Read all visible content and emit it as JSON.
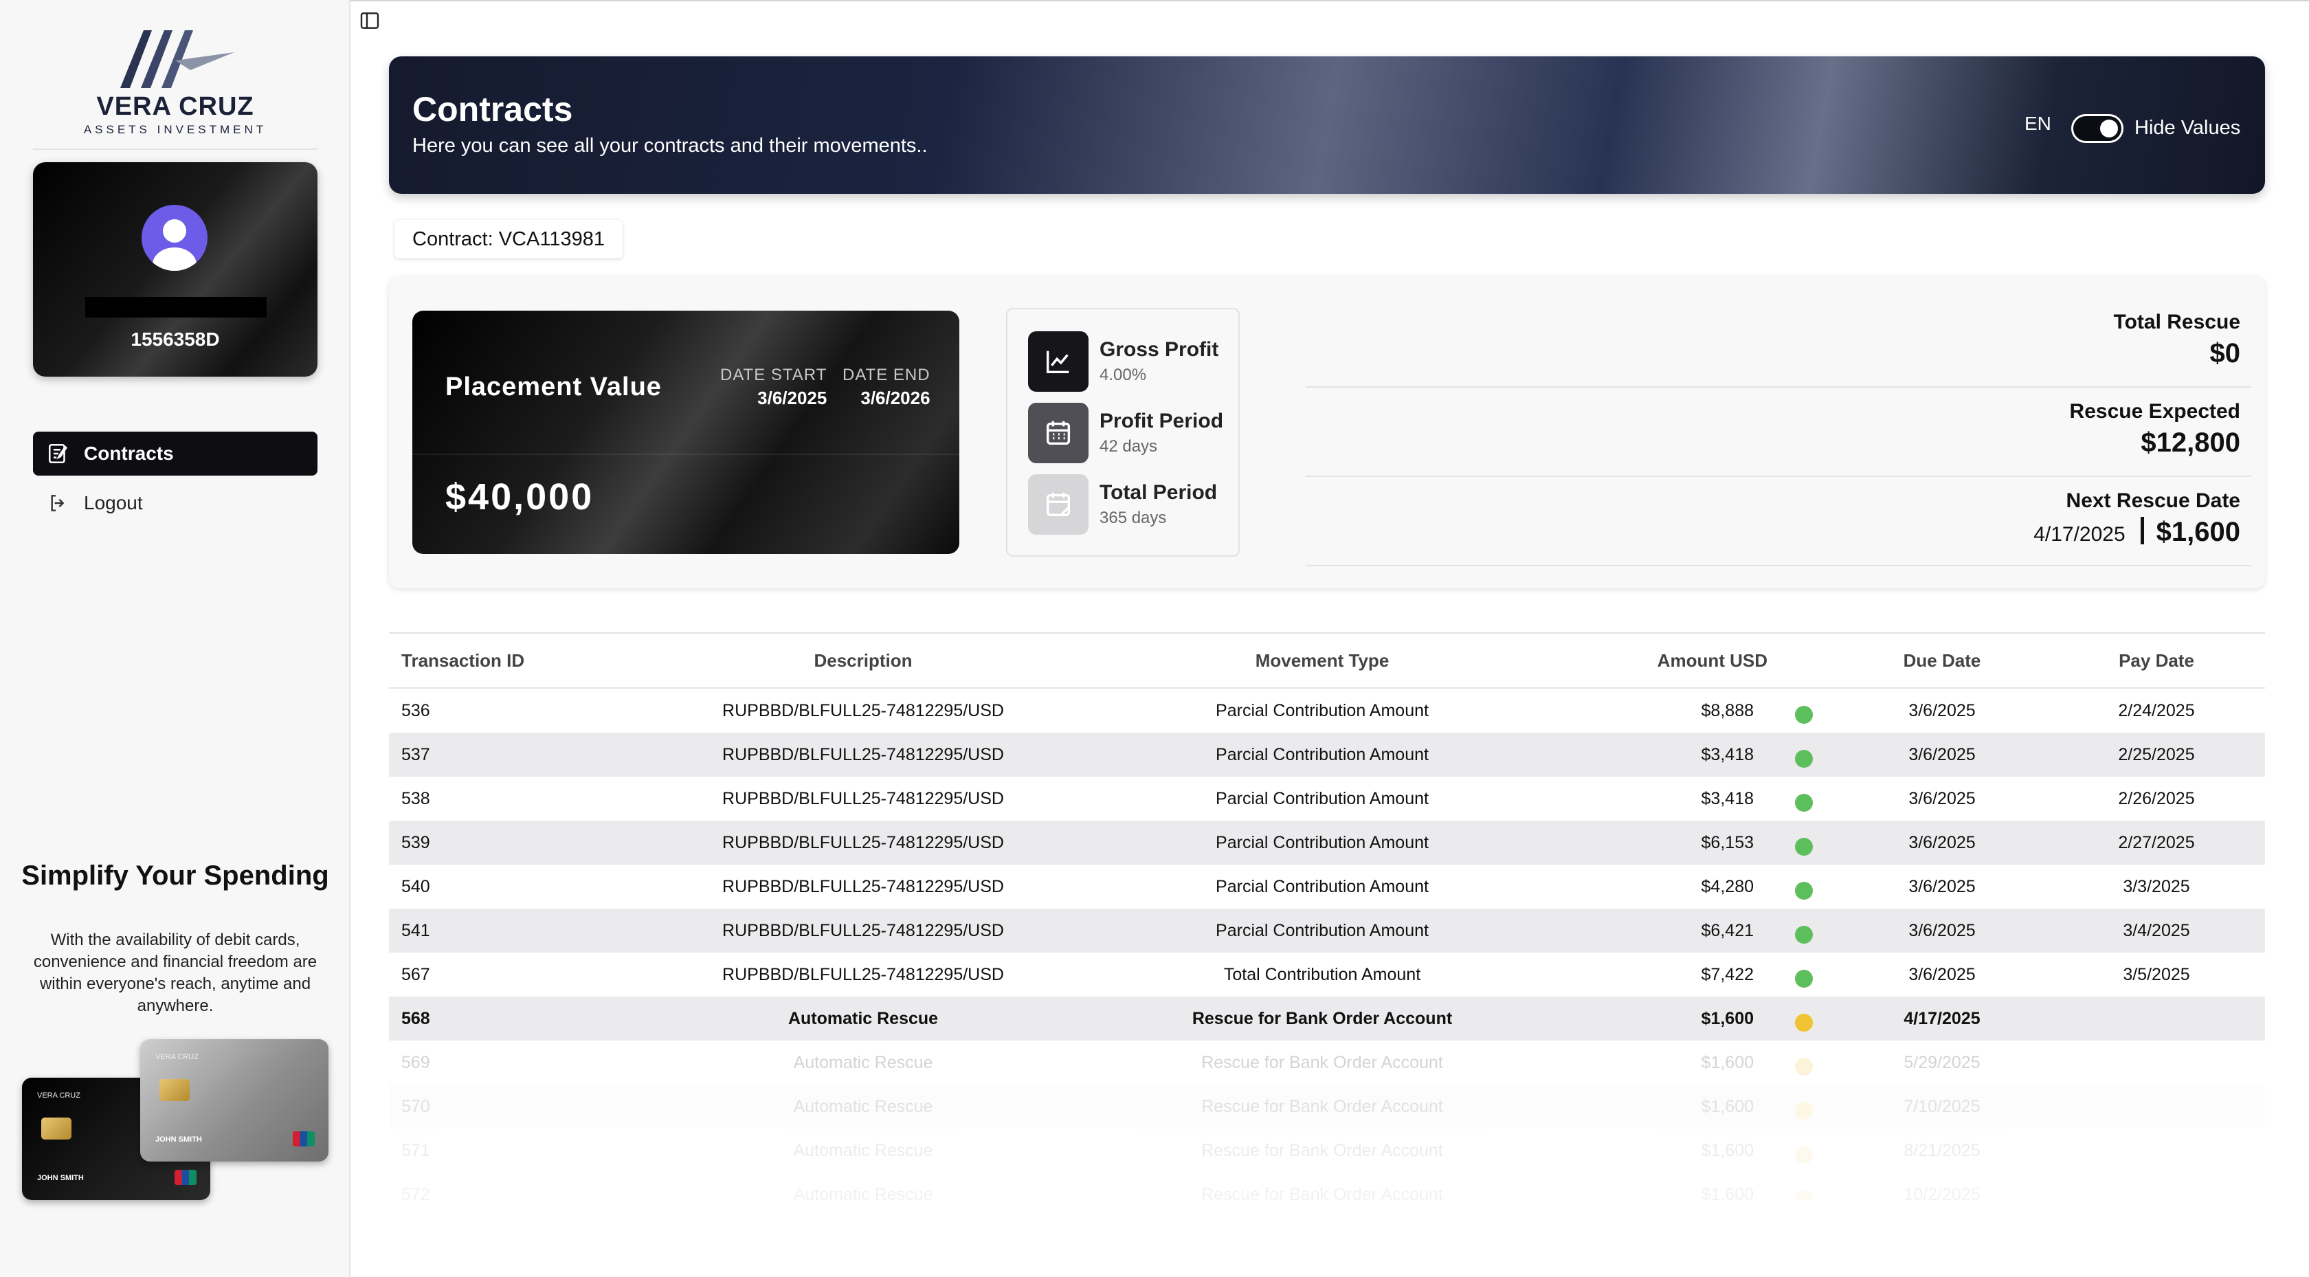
{
  "brand": {
    "name": "VERA CRUZ",
    "subtitle": "ASSETS INVESTMENT"
  },
  "profile": {
    "id": "1556358D"
  },
  "nav": [
    {
      "label": "Contracts",
      "icon": "contract-icon",
      "active": true
    },
    {
      "label": "Logout",
      "icon": "logout-icon",
      "active": false
    }
  ],
  "promo": {
    "title": "Simplify Your Spending",
    "text": "With the availability of debit cards, convenience and financial freedom are within everyone's reach, anytime and anywhere.",
    "card_brand": "VERA CRUZ",
    "card_holder": "JOHN SMITH"
  },
  "header": {
    "title": "Contracts",
    "subtitle": "Here you can see all your contracts and their movements..",
    "language": "EN",
    "hide_values_label": "Hide Values",
    "hide_values_on": true
  },
  "contract": {
    "label": "Contract: VCA113981"
  },
  "placement": {
    "label": "Placement Value",
    "value": "$40,000",
    "date_start_label": "DATE START",
    "date_start": "3/6/2025",
    "date_end_label": "DATE END",
    "date_end": "3/6/2026"
  },
  "stats": [
    {
      "title": "Gross Profit",
      "value": "4.00%",
      "icon": "chart-line-icon"
    },
    {
      "title": "Profit Period",
      "value": "42 days",
      "icon": "calendar-icon"
    },
    {
      "title": "Total Period",
      "value": "365 days",
      "icon": "calendar-note-icon"
    }
  ],
  "rescue": {
    "total_label": "Total Rescue",
    "total_value": "$0",
    "expected_label": "Rescue Expected",
    "expected_value": "$12,800",
    "next_label": "Next Rescue Date",
    "next_date": "4/17/2025",
    "next_value": "$1,600"
  },
  "table": {
    "columns": [
      "Transaction ID",
      "Description",
      "Movement Type",
      "Amount USD",
      "Due Date",
      "Pay Date"
    ],
    "status_colors": {
      "paid": "#5cbf5c",
      "pending": "#f1c232"
    },
    "rows": [
      {
        "id": "536",
        "desc": "RUPBBD/BLFULL25-74812295/USD",
        "type": "Parcial Contribution Amount",
        "amount": "$8,888",
        "status": "paid",
        "due": "3/6/2025",
        "pay": "2/24/2025"
      },
      {
        "id": "537",
        "desc": "RUPBBD/BLFULL25-74812295/USD",
        "type": "Parcial Contribution Amount",
        "amount": "$3,418",
        "status": "paid",
        "due": "3/6/2025",
        "pay": "2/25/2025"
      },
      {
        "id": "538",
        "desc": "RUPBBD/BLFULL25-74812295/USD",
        "type": "Parcial Contribution Amount",
        "amount": "$3,418",
        "status": "paid",
        "due": "3/6/2025",
        "pay": "2/26/2025"
      },
      {
        "id": "539",
        "desc": "RUPBBD/BLFULL25-74812295/USD",
        "type": "Parcial Contribution Amount",
        "amount": "$6,153",
        "status": "paid",
        "due": "3/6/2025",
        "pay": "2/27/2025"
      },
      {
        "id": "540",
        "desc": "RUPBBD/BLFULL25-74812295/USD",
        "type": "Parcial Contribution Amount",
        "amount": "$4,280",
        "status": "paid",
        "due": "3/6/2025",
        "pay": "3/3/2025"
      },
      {
        "id": "541",
        "desc": "RUPBBD/BLFULL25-74812295/USD",
        "type": "Parcial Contribution Amount",
        "amount": "$6,421",
        "status": "paid",
        "due": "3/6/2025",
        "pay": "3/4/2025"
      },
      {
        "id": "567",
        "desc": "RUPBBD/BLFULL25-74812295/USD",
        "type": "Total Contribution Amount",
        "amount": "$7,422",
        "status": "paid",
        "due": "3/6/2025",
        "pay": "3/5/2025"
      },
      {
        "id": "568",
        "desc": "Automatic Rescue",
        "type": "Rescue for Bank Order Account",
        "amount": "$1,600",
        "status": "pending",
        "due": "4/17/2025",
        "pay": ""
      },
      {
        "id": "569",
        "desc": "Automatic Rescue",
        "type": "Rescue for Bank Order Account",
        "amount": "$1,600",
        "status": "pending",
        "due": "5/29/2025",
        "pay": ""
      },
      {
        "id": "570",
        "desc": "Automatic Rescue",
        "type": "Rescue for Bank Order Account",
        "amount": "$1,600",
        "status": "pending",
        "due": "7/10/2025",
        "pay": ""
      },
      {
        "id": "571",
        "desc": "Automatic Rescue",
        "type": "Rescue for Bank Order Account",
        "amount": "$1,600",
        "status": "pending",
        "due": "8/21/2025",
        "pay": ""
      },
      {
        "id": "572",
        "desc": "Automatic Rescue",
        "type": "Rescue for Bank Order Account",
        "amount": "$1,600",
        "status": "pending",
        "due": "10/2/2025",
        "pay": ""
      }
    ]
  }
}
